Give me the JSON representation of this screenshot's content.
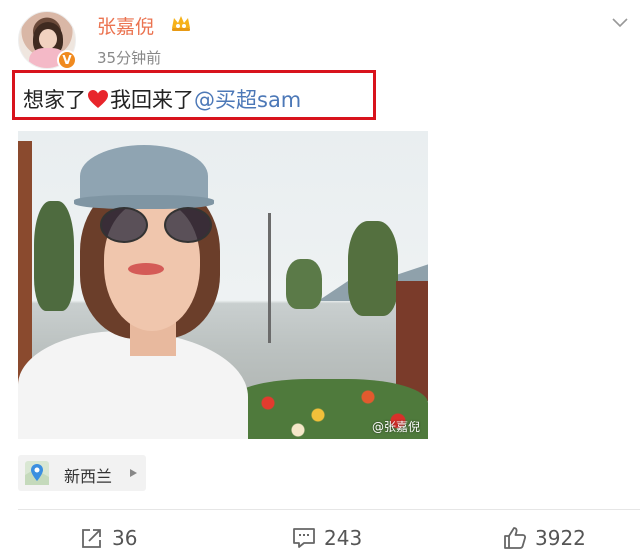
{
  "post": {
    "author": "张嘉倪",
    "time": "35分钟前",
    "text_before": "想家了",
    "text_after": "我回来了",
    "mention": "@买超sam",
    "watermark": "@张嘉倪"
  },
  "location": {
    "label": "新西兰"
  },
  "actions": {
    "repost_count": "36",
    "comment_count": "243",
    "like_count": "3922"
  },
  "colors": {
    "username": "#eb7350",
    "mention": "#4c78b7",
    "highlight_border": "#d8131c",
    "verified": "#f08a1f"
  },
  "icons": [
    "verified-v-icon",
    "vip-crown-icon",
    "chevron-down-icon",
    "heart-icon",
    "location-pin-icon",
    "repost-icon",
    "comment-icon",
    "like-icon"
  ]
}
